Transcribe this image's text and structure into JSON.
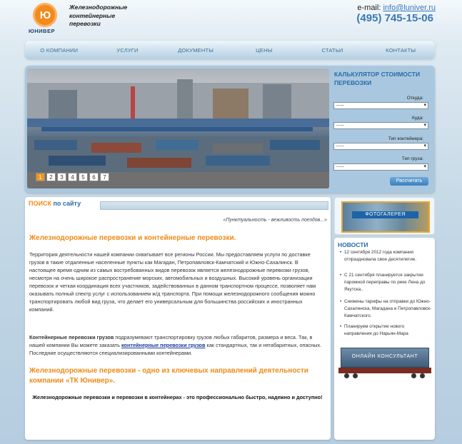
{
  "header": {
    "logo_mark": "Ю",
    "logo_text": "ЮНИВЕР",
    "tagline": [
      "Железнодорожные",
      "контейнерные",
      "перевозки"
    ],
    "email_label": "e-mail:",
    "email": "info@luniver.ru",
    "phone": "(495) 745-15-06"
  },
  "nav": [
    "О КОМПАНИИ",
    "УСЛУГИ",
    "ДОКУМЕНТЫ",
    "ЦЕНЫ",
    "СТАТЬИ",
    "КОНТАКТЫ"
  ],
  "slider": {
    "pages": [
      "1",
      "2",
      "3",
      "4",
      "5",
      "6",
      "7"
    ],
    "active_page": "1"
  },
  "calculator": {
    "title": "КАЛЬКУЛЯТОР СТОИМОСТИ ПЕРЕВОЗКИ",
    "fields": [
      {
        "label": "Откуда:",
        "value": "-----"
      },
      {
        "label": "Куда:",
        "value": "-----"
      },
      {
        "label": "Тип контейнера:",
        "value": "-----"
      },
      {
        "label": "Тип груза:",
        "value": "-----"
      }
    ],
    "button": "Рассчитать"
  },
  "search": {
    "title_accent": "ПОИСК",
    "title_rest": " по сайту"
  },
  "main": {
    "quote": "«Пунктуальность - вежливость поездов...»",
    "heading1": "Железнодорожные перевозки и контейнерные перевозки.",
    "para1": "Территория деятельности нашей компании охватывает все регионы России. Мы предоставляем услуги по доставке грузов в такие отдаленные населенные пункты как Магадан, Петропавловск-Камчатский и Южно-Сахалинск. В настоящее время одним из самых востребованных видов перевозок является железнодорожные перевозки грузов, несмотря на очень широкое распространение морских, автомобильных и воздушных. Высокий уровень организации перевозок и четкая координация всех участников, задействованных в данном транспортном процессе, позволяет нам оказывать полный спектр услуг с использованием ж/д транспорта. При помощи железнодорожного сообщения можно транспортировать любой вид груза, что делает его универсальным для большинства российских и иностранных компаний.",
    "para2_bold": "Контейнерные перевозки грузов",
    "para2_a": " подразумевают транспортировку грузов любых габаритов, размера и веса. Так, в нашей компании Вы можете заказать ",
    "para2_link": "контейнерные перевозки грузов",
    "para2_b": " как стандартных, так и негабаритных, опасных. Последние осуществляются специализированными контейнерами.",
    "heading2": "Железнодорожные перевозки - одно из ключевых направлений деятельности компании «ТК Юнивер».",
    "closing": "Железнодорожные перевозки и перевозки в контейнерах - это профессионально быстро, надежно и доступно!"
  },
  "sidebar": {
    "photo_banner": "ФОТОГАЛЕРЕЯ",
    "news_title": "НОВОСТИ",
    "news": [
      "12 сентября 2012 года компания отпраздновала свое десятилетие.",
      "С 21 сентября планируется закрытие паромной переправы по реке Лена до Якутска..",
      "Снижены тарифы на отправки до Южно-Сахалинска, Магадана и Петропавловск-Камчатского.",
      "Планируем открытие нового направления до Нарьян-Мара"
    ],
    "consultant_banner": "ОНЛАЙН   КОНСУЛЬТАНТ"
  }
}
